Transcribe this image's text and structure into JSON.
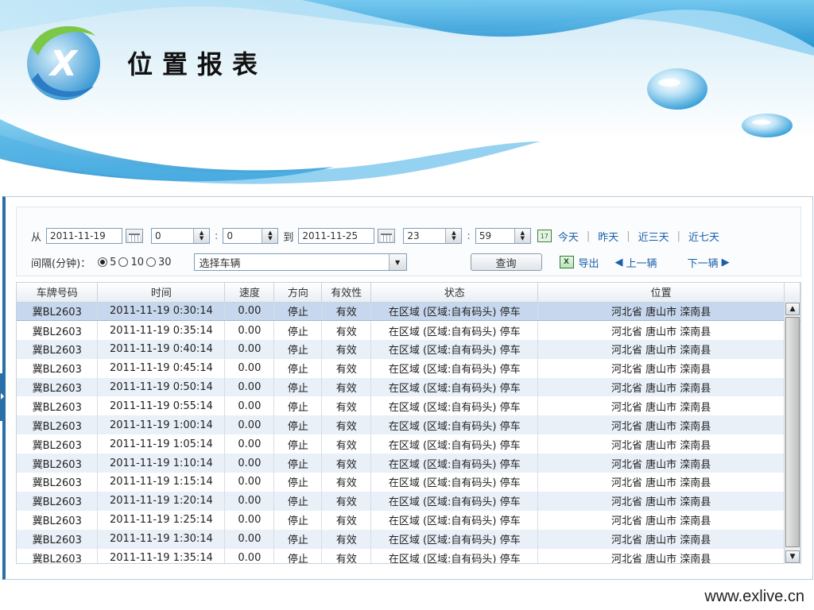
{
  "header": {
    "title": "位置报表",
    "logo_letter": "X"
  },
  "filter": {
    "from_label": "从",
    "start_date": "2011-11-19",
    "start_hour": "0",
    "start_minute": "0",
    "to_label": "到",
    "end_date": "2011-11-25",
    "end_hour": "23",
    "end_minute": "59",
    "today_icon_text": "17",
    "quick_ranges": [
      "今天",
      "昨天",
      "近三天",
      "近七天"
    ],
    "interval_label": "间隔(分钟)：",
    "interval_options": [
      "5",
      "10",
      "30"
    ],
    "interval_selected": "5",
    "vehicle_select": "选择车辆",
    "query_label": "查询",
    "excel_icon_text": "X",
    "export_label": "导出",
    "prev_label": "上一辆",
    "next_label": "下一辆"
  },
  "table": {
    "columns": [
      "车牌号码",
      "时间",
      "速度",
      "方向",
      "有效性",
      "状态",
      "位置"
    ],
    "rows": [
      [
        "冀BL2603",
        "2011-11-19 0:30:14",
        "0.00",
        "停止",
        "有效",
        "在区域 (区域:自有码头) 停车",
        "河北省 唐山市 滦南县"
      ],
      [
        "冀BL2603",
        "2011-11-19 0:35:14",
        "0.00",
        "停止",
        "有效",
        "在区域 (区域:自有码头) 停车",
        "河北省 唐山市 滦南县"
      ],
      [
        "冀BL2603",
        "2011-11-19 0:40:14",
        "0.00",
        "停止",
        "有效",
        "在区域 (区域:自有码头) 停车",
        "河北省 唐山市 滦南县"
      ],
      [
        "冀BL2603",
        "2011-11-19 0:45:14",
        "0.00",
        "停止",
        "有效",
        "在区域 (区域:自有码头) 停车",
        "河北省 唐山市 滦南县"
      ],
      [
        "冀BL2603",
        "2011-11-19 0:50:14",
        "0.00",
        "停止",
        "有效",
        "在区域 (区域:自有码头) 停车",
        "河北省 唐山市 滦南县"
      ],
      [
        "冀BL2603",
        "2011-11-19 0:55:14",
        "0.00",
        "停止",
        "有效",
        "在区域 (区域:自有码头) 停车",
        "河北省 唐山市 滦南县"
      ],
      [
        "冀BL2603",
        "2011-11-19 1:00:14",
        "0.00",
        "停止",
        "有效",
        "在区域 (区域:自有码头) 停车",
        "河北省 唐山市 滦南县"
      ],
      [
        "冀BL2603",
        "2011-11-19 1:05:14",
        "0.00",
        "停止",
        "有效",
        "在区域 (区域:自有码头) 停车",
        "河北省 唐山市 滦南县"
      ],
      [
        "冀BL2603",
        "2011-11-19 1:10:14",
        "0.00",
        "停止",
        "有效",
        "在区域 (区域:自有码头) 停车",
        "河北省 唐山市 滦南县"
      ],
      [
        "冀BL2603",
        "2011-11-19 1:15:14",
        "0.00",
        "停止",
        "有效",
        "在区域 (区域:自有码头) 停车",
        "河北省 唐山市 滦南县"
      ],
      [
        "冀BL2603",
        "2011-11-19 1:20:14",
        "0.00",
        "停止",
        "有效",
        "在区域 (区域:自有码头) 停车",
        "河北省 唐山市 滦南县"
      ],
      [
        "冀BL2603",
        "2011-11-19 1:25:14",
        "0.00",
        "停止",
        "有效",
        "在区域 (区域:自有码头) 停车",
        "河北省 唐山市 滦南县"
      ],
      [
        "冀BL2603",
        "2011-11-19 1:30:14",
        "0.00",
        "停止",
        "有效",
        "在区域 (区域:自有码头) 停车",
        "河北省 唐山市 滦南县"
      ],
      [
        "冀BL2603",
        "2011-11-19 1:35:14",
        "0.00",
        "停止",
        "有效",
        "在区域 (区域:自有码头) 停车",
        "河北省 唐山市 滦南县"
      ]
    ]
  },
  "footer": {
    "url": "www.exlive.cn"
  },
  "colors": {
    "accent": "#1a5fa8",
    "row_alt": "#e9f0f8",
    "row_selected": "#c7d8ee",
    "panel_border": "#2a6fa8"
  }
}
